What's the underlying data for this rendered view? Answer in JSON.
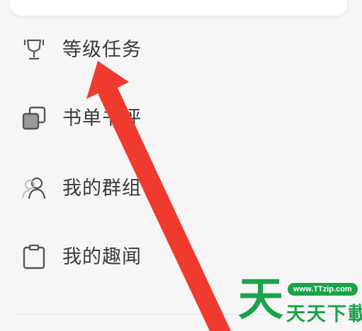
{
  "menu": {
    "items": [
      {
        "label": "等级任务",
        "icon": "trophy-icon"
      },
      {
        "label": "书单书评",
        "icon": "booklist-icon"
      },
      {
        "label": "我的群组",
        "icon": "group-icon"
      },
      {
        "label": "我的趣闻",
        "icon": "clipboard-icon"
      }
    ]
  },
  "watermark": {
    "big_char": "天",
    "url": "www.TTzip.com",
    "text": "天天下載"
  },
  "colors": {
    "arrow": "#f03a2e",
    "watermark": "#1aa34a",
    "text": "#3a3a3a",
    "icon": "#555555"
  }
}
